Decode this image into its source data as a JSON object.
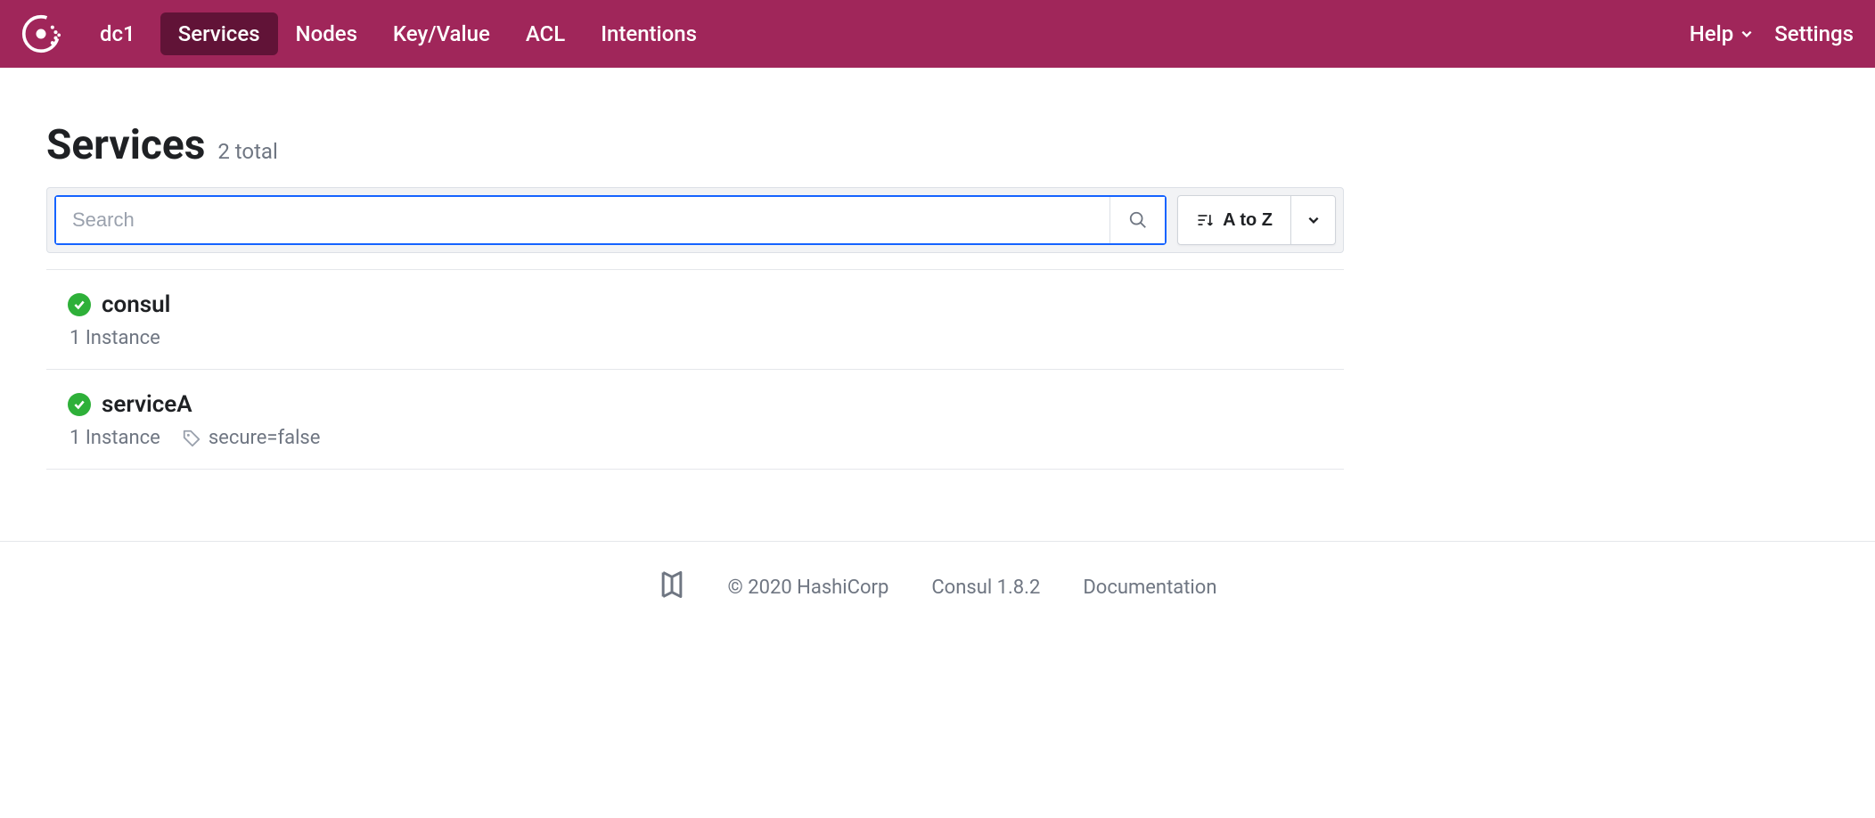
{
  "header": {
    "datacenter": "dc1",
    "nav": {
      "services": "Services",
      "nodes": "Nodes",
      "kv": "Key/Value",
      "acl": "ACL",
      "intentions": "Intentions"
    },
    "help": "Help",
    "settings": "Settings"
  },
  "page": {
    "title": "Services",
    "count_label": "2 total"
  },
  "search": {
    "placeholder": "Search",
    "value": ""
  },
  "sort": {
    "label": "A to Z"
  },
  "services": [
    {
      "name": "consul",
      "instances_label": "1 Instance",
      "tag": ""
    },
    {
      "name": "serviceA",
      "instances_label": "1 Instance",
      "tag": "secure=false"
    }
  ],
  "footer": {
    "copyright": "© 2020 HashiCorp",
    "version": "Consul 1.8.2",
    "docs": "Documentation"
  }
}
